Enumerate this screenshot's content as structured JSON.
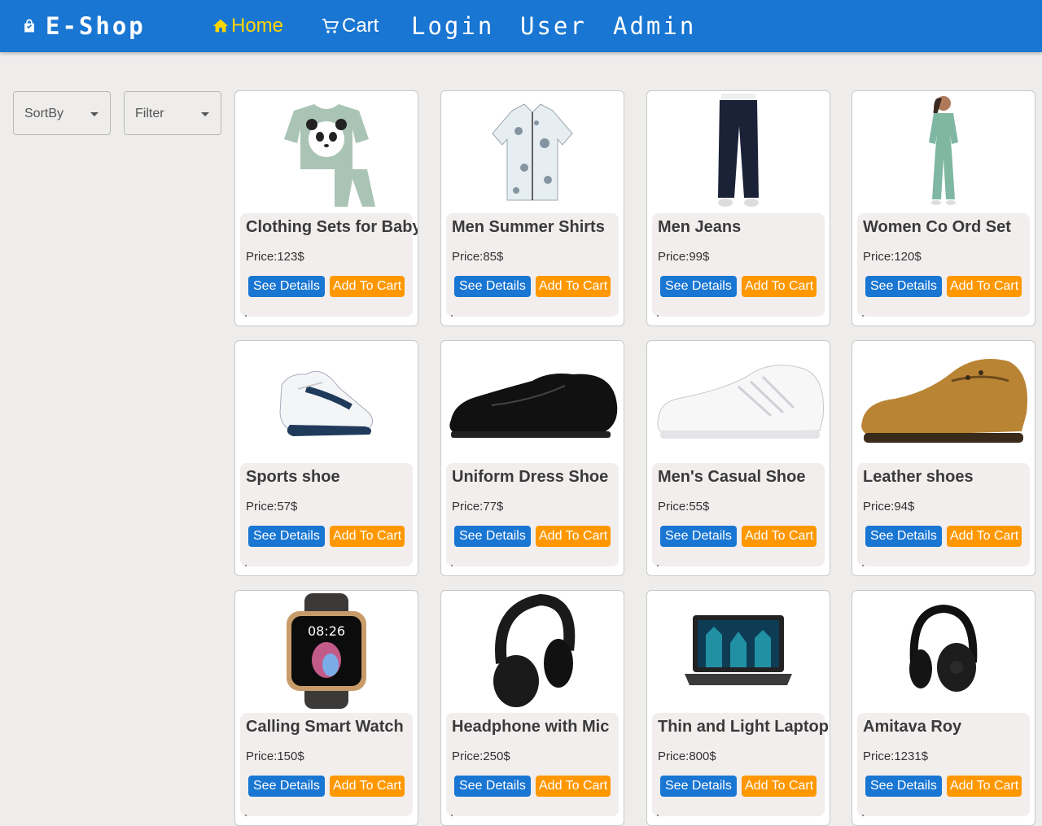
{
  "header": {
    "brand": "E-Shop",
    "nav": {
      "home": "Home",
      "cart": "Cart",
      "login": "Login",
      "user": "User",
      "admin": "Admin"
    }
  },
  "controls": {
    "sort_label": "SortBy",
    "filter_label": "Filter"
  },
  "buttons": {
    "details": "See Details",
    "add_to_cart": "Add To Cart"
  },
  "products": [
    {
      "name": "Clothing Sets for Baby",
      "price": "Price:123$",
      "image": "baby-clothing-set"
    },
    {
      "name": "Men Summer Shirts",
      "price": "Price:85$",
      "image": "summer-shirt"
    },
    {
      "name": "Men Jeans",
      "price": "Price:99$",
      "image": "jeans"
    },
    {
      "name": "Women Co Ord Set",
      "price": "Price:120$",
      "image": "co-ord-set"
    },
    {
      "name": "Sports shoe",
      "price": "Price:57$",
      "image": "sports-shoe"
    },
    {
      "name": "Uniform Dress Shoe",
      "price": "Price:77$",
      "image": "dress-shoe"
    },
    {
      "name": "Men's Casual Shoe",
      "price": "Price:55$",
      "image": "casual-shoe"
    },
    {
      "name": "Leather shoes",
      "price": "Price:94$",
      "image": "leather-shoe"
    },
    {
      "name": "Calling Smart Watch",
      "price": "Price:150$",
      "image": "smart-watch",
      "watch_time": "08:26"
    },
    {
      "name": "Headphone with Mic",
      "price": "Price:250$",
      "image": "headphone"
    },
    {
      "name": "Thin and Light Laptop",
      "price": "Price:800$",
      "image": "laptop"
    },
    {
      "name": "Amitava Roy",
      "price": "Price:1231$",
      "image": "headphone-round"
    }
  ],
  "colors": {
    "appbar": "#1976d2",
    "home_active": "#ffd600",
    "details_button": "#1976d2",
    "cart_button": "#ff9800",
    "page_bg": "#eeedec",
    "card_info_bg": "#f1eeed"
  }
}
